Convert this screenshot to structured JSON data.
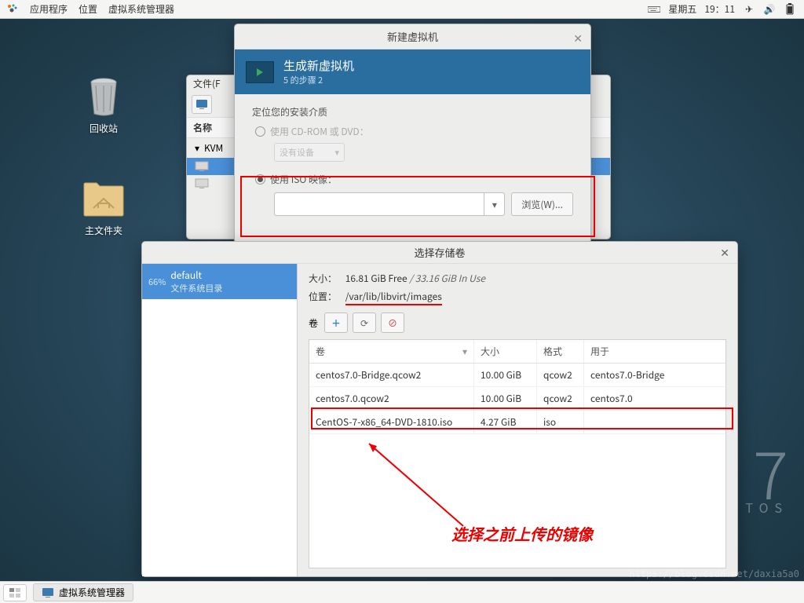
{
  "panel": {
    "apps": "应用程序",
    "places": "位置",
    "vmm": "虚拟系统管理器",
    "day": "星期五",
    "time": "19：11"
  },
  "desktop": {
    "trash": "回收站",
    "home": "主文件夹"
  },
  "vmwin": {
    "file_menu": "文件(F",
    "name_col": "名称",
    "hypervisor": "KVM"
  },
  "newvm": {
    "title": "新建虚拟机",
    "banner_title": "生成新虚拟机",
    "banner_sub": "5 的步骤 2",
    "locate": "定位您的安装介质",
    "use_cdrom": "使用 CD-ROM 或 DVD：",
    "no_device": "没有设备",
    "use_iso": "使用 ISO 映像：",
    "browse": "浏览(W)..."
  },
  "vol": {
    "title": "选择存储卷",
    "pool_pct": "66%",
    "pool_name": "default",
    "pool_sub": "文件系统目录",
    "size_lbl": "大小：",
    "size_free": "16.81 GiB Free",
    "size_sep": " / ",
    "size_used": "33.16 GiB In Use",
    "loc_lbl": "位置：",
    "loc_val": "/var/lib/libvirt/images",
    "vols_lbl": "卷",
    "head": {
      "c1": "卷",
      "c2": "大小",
      "c3": "格式",
      "c4": "用于"
    },
    "rows": [
      {
        "c1": "centos7.0-Bridge.qcow2",
        "c2": "10.00 GiB",
        "c3": "qcow2",
        "c4": "centos7.0-Bridge"
      },
      {
        "c1": "centos7.0.qcow2",
        "c2": "10.00 GiB",
        "c3": "qcow2",
        "c4": "centos7.0"
      },
      {
        "c1": "CentOS-7-x86_64-DVD-1810.iso",
        "c2": "4.27 GiB",
        "c3": "iso",
        "c4": ""
      }
    ]
  },
  "annotation": "选择之前上传的镜像",
  "brand": {
    "num": "7",
    "txt": "ENTOS"
  },
  "taskbar": {
    "app": "虚拟系统管理器"
  },
  "watermark": "https://blog.csdn.net/daxia5a0"
}
